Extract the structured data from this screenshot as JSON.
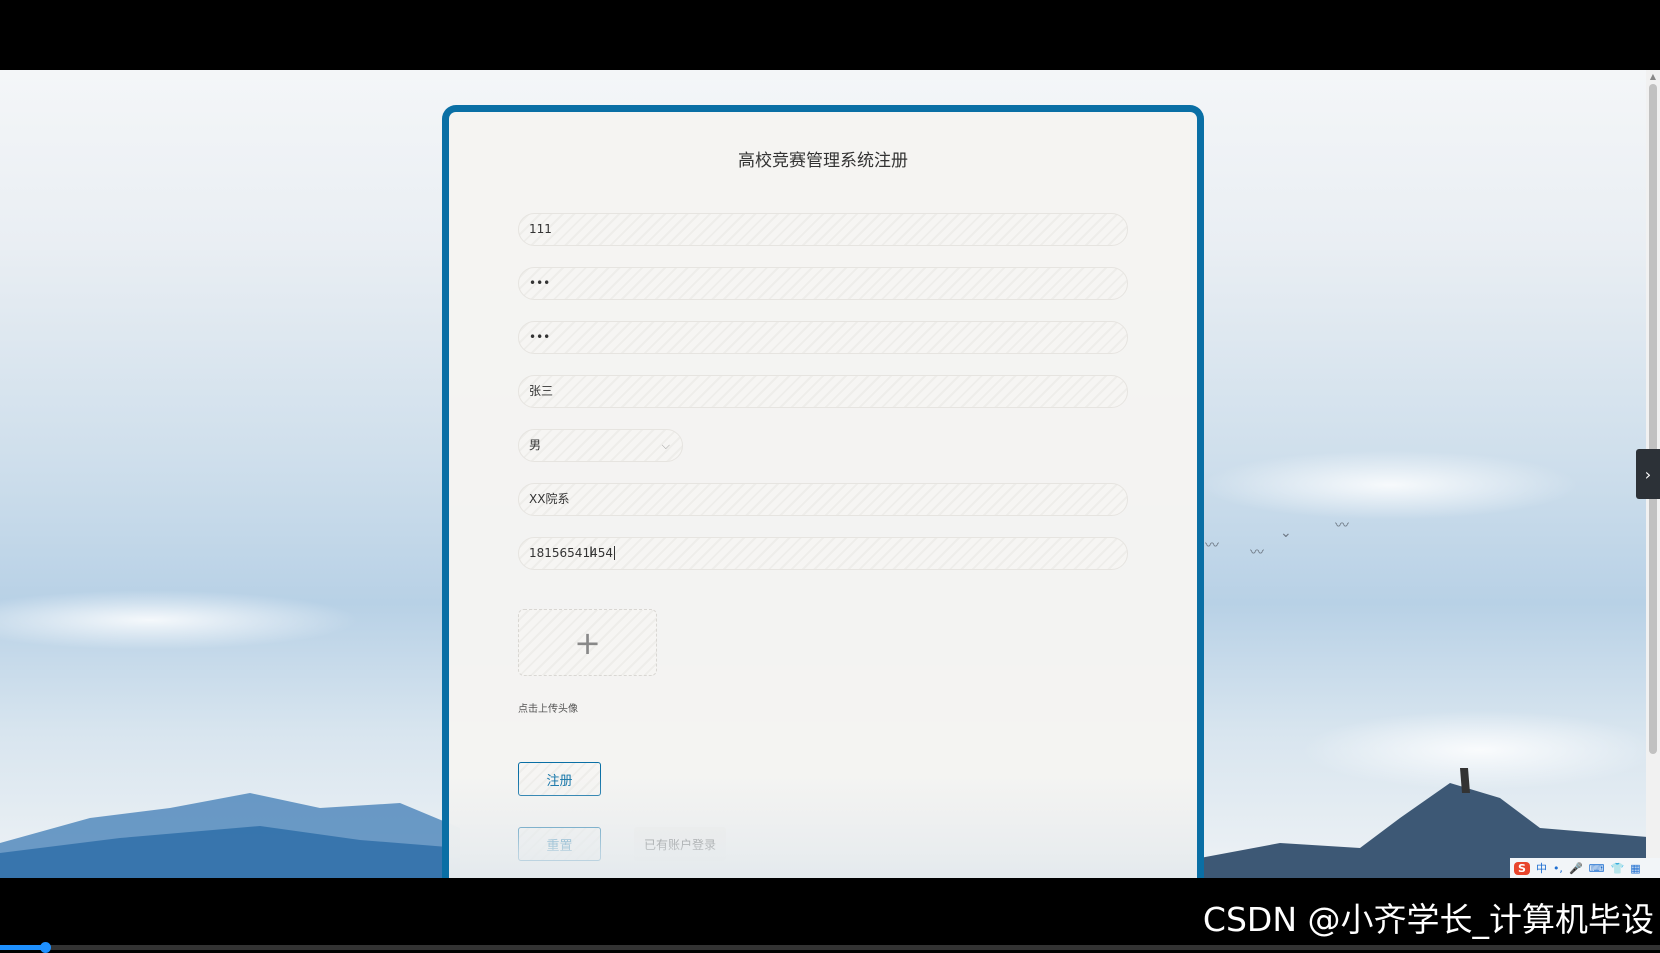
{
  "form": {
    "title": "高校竞赛管理系统注册",
    "fields": [
      {
        "name": "account",
        "value": "111"
      },
      {
        "name": "password",
        "value": "•••"
      },
      {
        "name": "confirm_password",
        "value": "•••"
      },
      {
        "name": "name",
        "value": "张三"
      },
      {
        "name": "gender",
        "value": "男"
      },
      {
        "name": "department",
        "value": "XX院系"
      },
      {
        "name": "phone",
        "value": "18156541454"
      }
    ],
    "upload_hint": "点击上传头像",
    "register_label": "注册",
    "reset_label": "重置",
    "login_link": "已有账户登录"
  },
  "watermark": "CSDN @小齐学长_计算机毕设",
  "ime": {
    "logo": "S",
    "mode": "中"
  },
  "colors": {
    "accent": "#0a6fa5"
  }
}
